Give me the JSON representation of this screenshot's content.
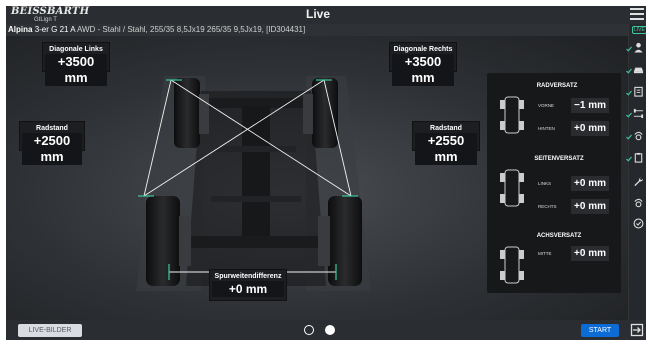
{
  "header": {
    "brand": "BEISSBARTH",
    "brand_sub": "GtLign T",
    "title": "Live",
    "vehicle_make": "Alpina",
    "vehicle_model": "3-er G 21 A",
    "vehicle_details": "AWD - Stahl / Stahl, 255/35 8,5Jx19 265/35 9,5Jx19, [ID304431]"
  },
  "measurements": {
    "diagonale_links": {
      "label": "Diagonale Links",
      "value": "+3500 mm"
    },
    "diagonale_rechts": {
      "label": "Diagonale Rechts",
      "value": "+3500 mm"
    },
    "radstand_links": {
      "label": "Radstand",
      "value": "+2500 mm"
    },
    "radstand_rechts": {
      "label": "Radstand",
      "value": "+2550 mm"
    },
    "spurweitendifferenz": {
      "label": "Spurweitendifferenz",
      "value": "+0 mm"
    }
  },
  "panel": {
    "radversatz": {
      "title": "RADVERSATZ",
      "vorne_label": "VORNE",
      "vorne_value": "−1 mm",
      "hinten_label": "HINTEN",
      "hinten_value": "+0 mm"
    },
    "seitenversatz": {
      "title": "SEITENVERSATZ",
      "links_label": "LINKS",
      "links_value": "+0 mm",
      "rechts_label": "RECHTS",
      "rechts_value": "+0 mm"
    },
    "achsversatz": {
      "title": "ACHSVERSATZ",
      "mitte_label": "MITTE",
      "mitte_value": "+0 mm"
    }
  },
  "sidebar": {
    "live_tag": "LIVE"
  },
  "bottombar": {
    "live_bilder": "LIVE-BILDER",
    "start": "START"
  },
  "colors": {
    "accent": "#0d6bd6",
    "check": "#3cc8a0",
    "background": "#1d1f22"
  }
}
